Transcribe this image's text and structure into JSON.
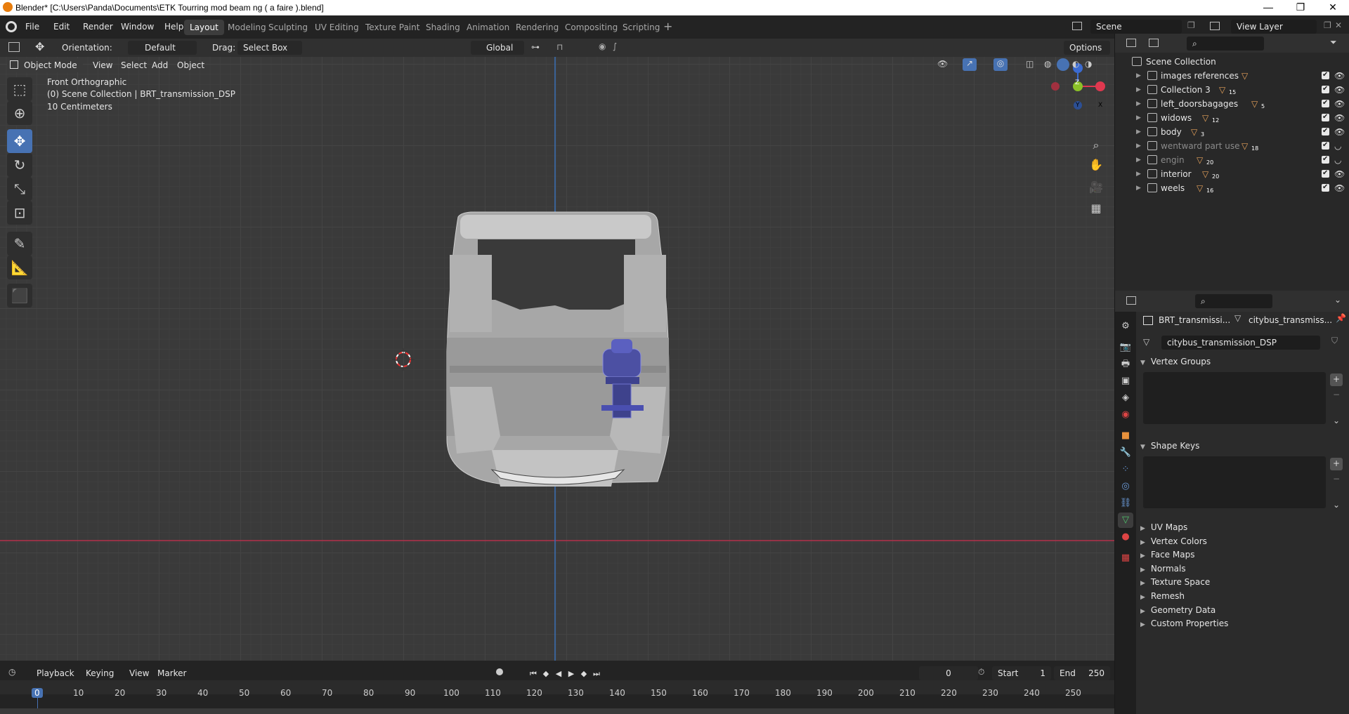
{
  "window": {
    "title": "Blender* [C:\\Users\\Panda\\Documents\\ETK Tourring mod beam ng ( a faire ).blend]",
    "minimize": "—",
    "maximize": "❐",
    "close": "✕"
  },
  "menu": [
    "File",
    "Edit",
    "Render",
    "Window",
    "Help"
  ],
  "workspaces": [
    "Layout",
    "Modeling",
    "Sculpting",
    "UV Editing",
    "Texture Paint",
    "Shading",
    "Animation",
    "Rendering",
    "Compositing",
    "Scripting"
  ],
  "active_workspace": "Layout",
  "scene": {
    "name": "Scene",
    "view_layer": "View Layer"
  },
  "toolheader": {
    "orientation_label": "Orientation:",
    "orientation_value": "Default",
    "drag_label": "Drag:",
    "drag_value": "Select Box",
    "transform_orientation": "Global",
    "options": "Options"
  },
  "viewport_header": {
    "mode": "Object Mode",
    "menus": [
      "View",
      "Select",
      "Add",
      "Object"
    ]
  },
  "viewport_info": {
    "view": "Front Orthographic",
    "collection": "(0) Scene Collection | BRT_transmission_DSP",
    "scale": "10 Centimeters"
  },
  "gizmo": {
    "z": "Z",
    "y": "Y",
    "x": "X"
  },
  "outliner": {
    "root": "Scene Collection",
    "items": [
      {
        "name": "images references",
        "badge": "",
        "dim": false
      },
      {
        "name": "Collection 3",
        "badge": "15",
        "dim": false
      },
      {
        "name": "left_doorsbagages",
        "badge": "5",
        "dim": false
      },
      {
        "name": "widows",
        "badge": "12",
        "dim": false
      },
      {
        "name": "body",
        "badge": "3",
        "dim": false
      },
      {
        "name": "wentward part use",
        "badge": "18",
        "dim": true
      },
      {
        "name": "engin",
        "badge": "20",
        "dim": true
      },
      {
        "name": "interior",
        "badge": "20",
        "dim": false
      },
      {
        "name": "weels",
        "badge": "16",
        "dim": false
      }
    ]
  },
  "properties": {
    "object_name": "BRT_transmissi...",
    "mesh_name": "citybus_transmiss...",
    "data_field": "citybus_transmission_DSP",
    "panels_open": [
      "Vertex Groups",
      "Shape Keys"
    ],
    "panels_closed": [
      "UV Maps",
      "Vertex Colors",
      "Face Maps",
      "Normals",
      "Texture Space",
      "Remesh",
      "Geometry Data",
      "Custom Properties"
    ]
  },
  "timeline": {
    "menus": [
      "Playback",
      "Keying",
      "View",
      "Marker"
    ],
    "current_frame": "0",
    "start_label": "Start",
    "start": "1",
    "end_label": "End",
    "end": "250",
    "ticks": [
      "0",
      "10",
      "20",
      "30",
      "40",
      "50",
      "60",
      "70",
      "80",
      "90",
      "100",
      "110",
      "120",
      "130",
      "140",
      "150",
      "160",
      "170",
      "180",
      "190",
      "200",
      "210",
      "220",
      "230",
      "240",
      "250"
    ]
  }
}
